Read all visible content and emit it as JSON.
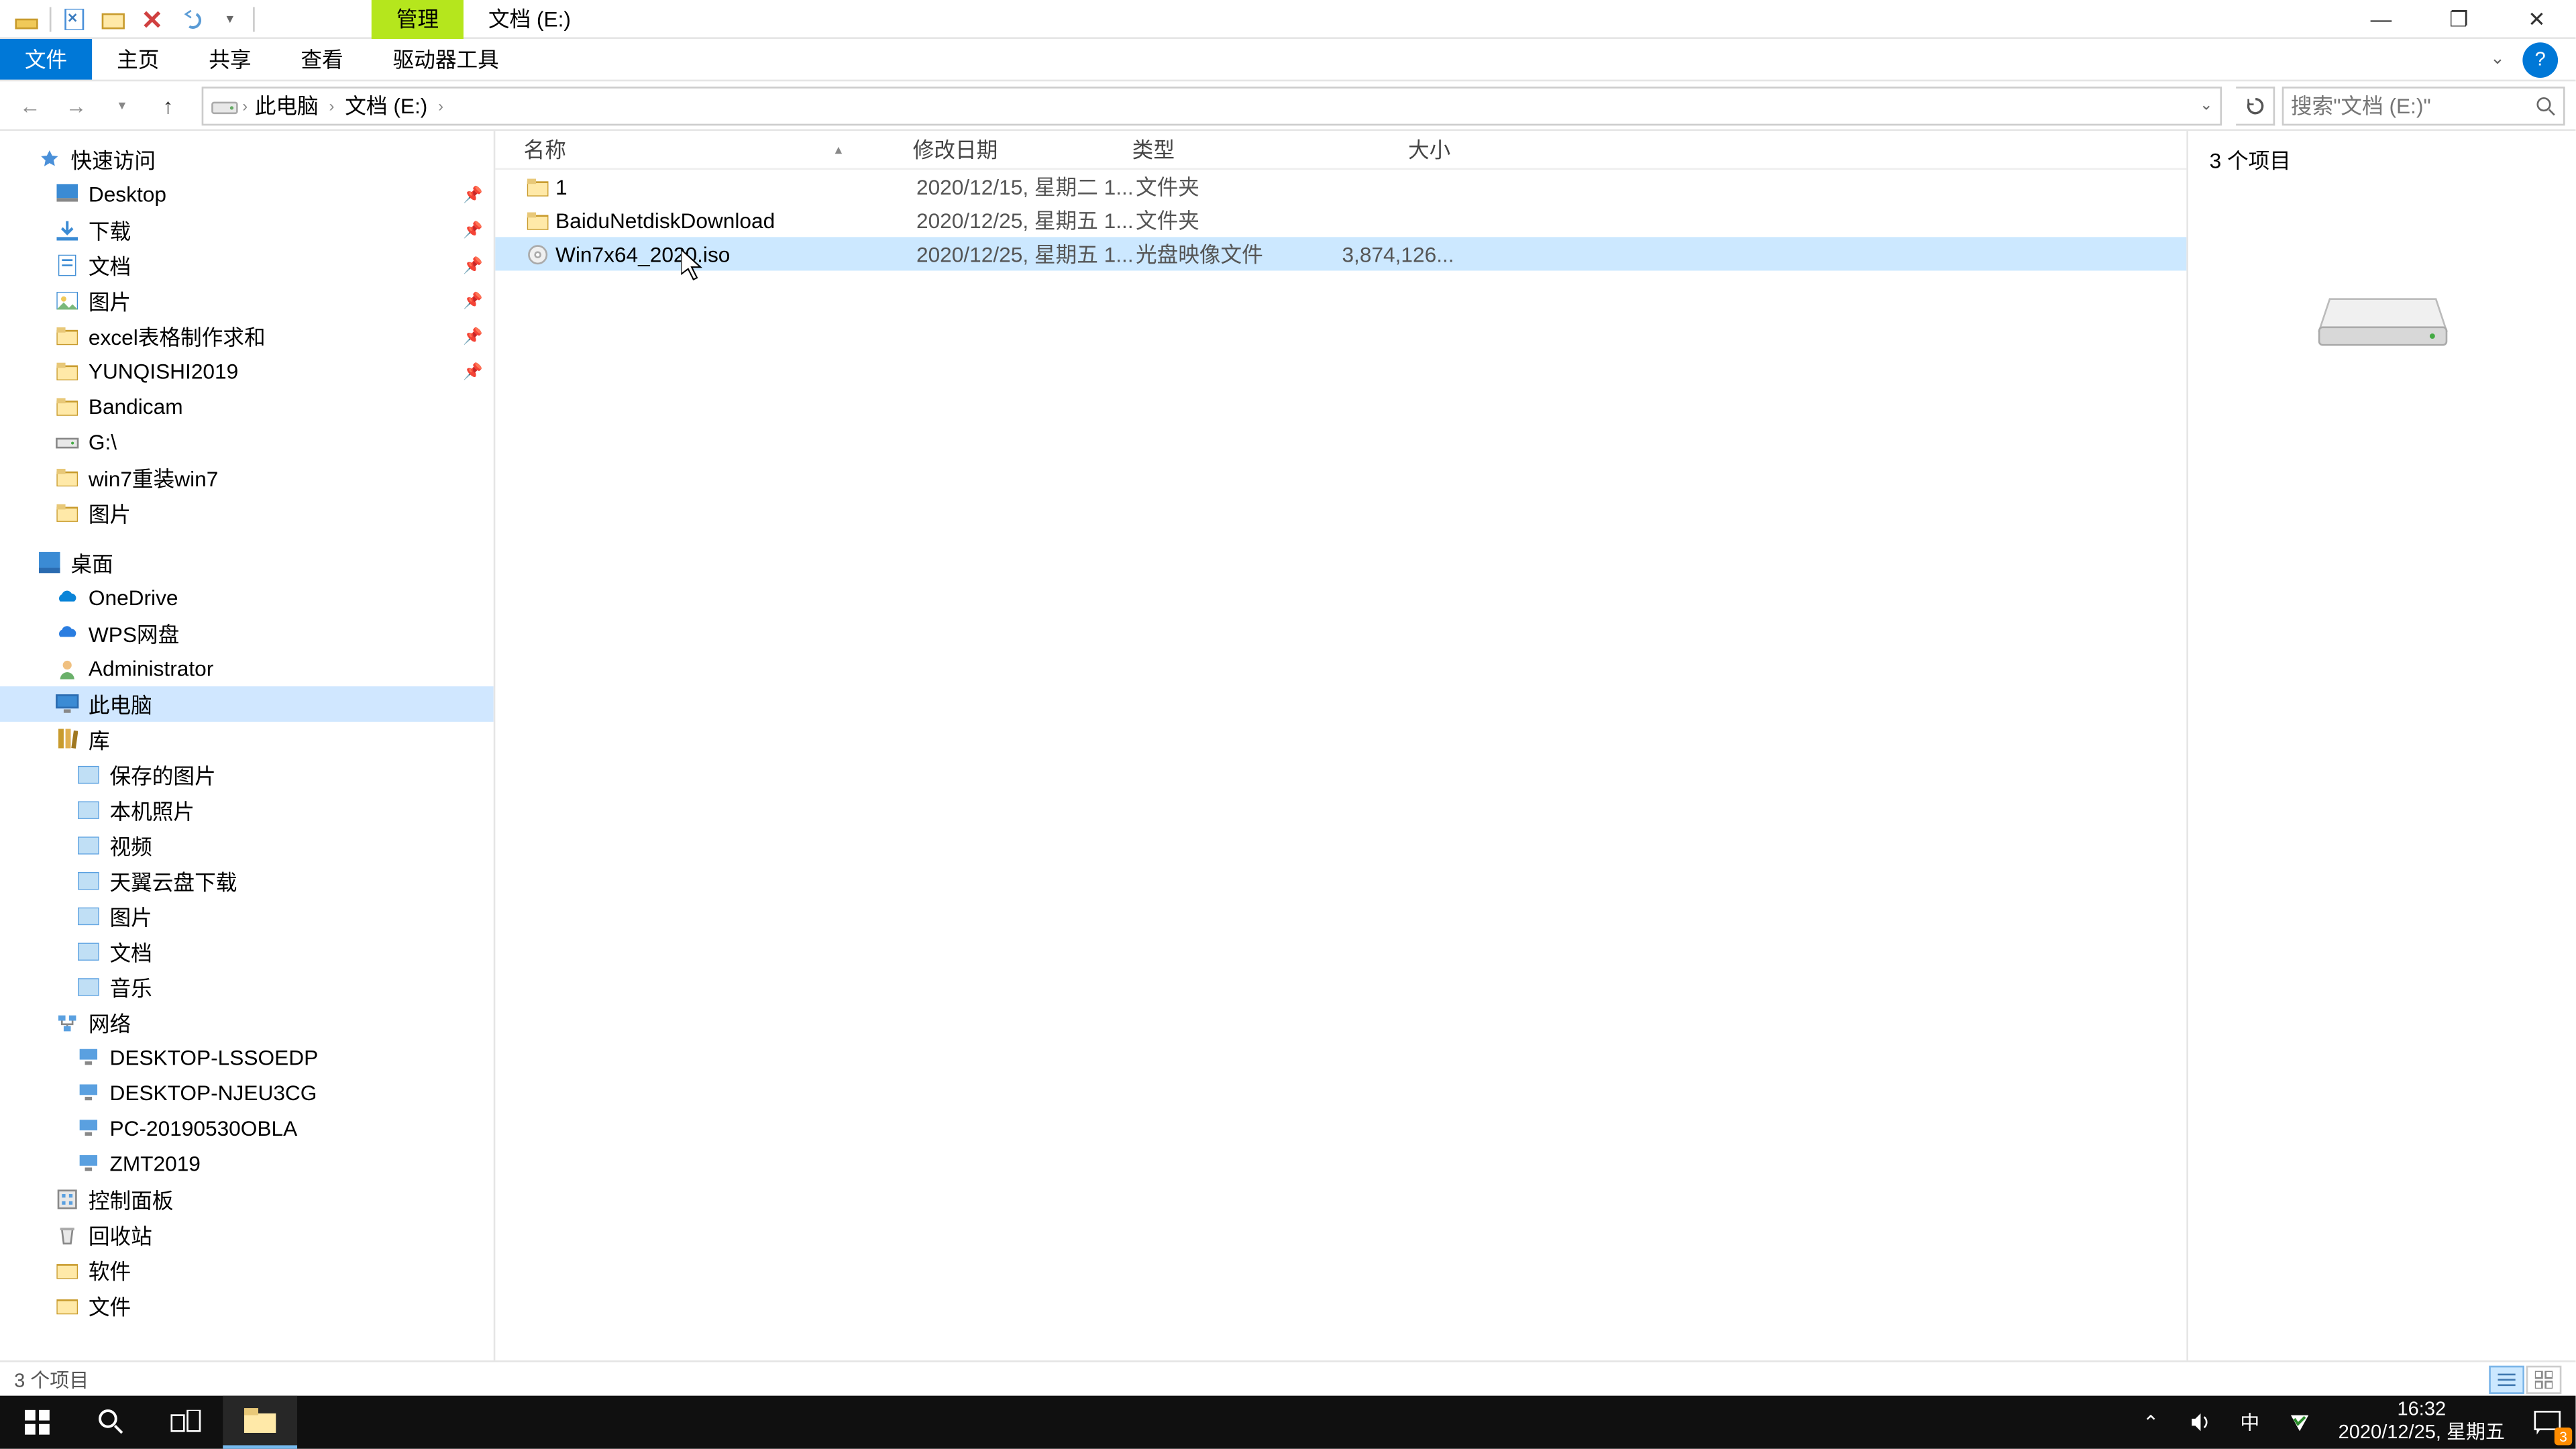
{
  "titlebar": {
    "context_tab": "管理",
    "title": "文档 (E:)"
  },
  "window_controls": {
    "minimize": "—",
    "maximize": "❐",
    "close": "✕"
  },
  "ribbon": {
    "file": "文件",
    "home": "主页",
    "share": "共享",
    "view": "查看",
    "drive_tools": "驱动器工具"
  },
  "nav": {
    "breadcrumb": [
      "此电脑",
      "文档 (E:)"
    ],
    "search_placeholder": "搜索\"文档 (E:)\""
  },
  "tree": {
    "quick_access": "快速访问",
    "qa_items": [
      {
        "label": "Desktop",
        "icon": "desktop"
      },
      {
        "label": "下载",
        "icon": "downloads"
      },
      {
        "label": "文档",
        "icon": "docs"
      },
      {
        "label": "图片",
        "icon": "pics"
      },
      {
        "label": "excel表格制作求和",
        "icon": "folder"
      },
      {
        "label": "YUNQISHI2019",
        "icon": "folder"
      },
      {
        "label": "Bandicam",
        "icon": "folder",
        "nopin": true
      },
      {
        "label": "G:\\",
        "icon": "drive",
        "nopin": true
      },
      {
        "label": "win7重装win7",
        "icon": "folder",
        "nopin": true
      },
      {
        "label": "图片",
        "icon": "folder",
        "nopin": true
      }
    ],
    "desktop": "桌面",
    "desktop_items": [
      {
        "label": "OneDrive",
        "icon": "onedrive"
      },
      {
        "label": "WPS网盘",
        "icon": "wps"
      },
      {
        "label": "Administrator",
        "icon": "user"
      },
      {
        "label": "此电脑",
        "icon": "pc",
        "selected": true
      },
      {
        "label": "库",
        "icon": "libs"
      }
    ],
    "lib_items": [
      {
        "label": "保存的图片"
      },
      {
        "label": "本机照片"
      },
      {
        "label": "视频"
      },
      {
        "label": "天翼云盘下载"
      },
      {
        "label": "图片"
      },
      {
        "label": "文档"
      },
      {
        "label": "音乐"
      }
    ],
    "network": "网络",
    "net_items": [
      {
        "label": "DESKTOP-LSSOEDP"
      },
      {
        "label": "DESKTOP-NJEU3CG"
      },
      {
        "label": "PC-20190530OBLA"
      },
      {
        "label": "ZMT2019"
      }
    ],
    "control_panel": "控制面板",
    "recycle": "回收站",
    "software": "软件",
    "docs2": "文件"
  },
  "columns": {
    "name": "名称",
    "date": "修改日期",
    "type": "类型",
    "size": "大小"
  },
  "files": [
    {
      "name": "1",
      "date": "2020/12/15, 星期二 1...",
      "type": "文件夹",
      "size": "",
      "icon": "folder"
    },
    {
      "name": "BaiduNetdiskDownload",
      "date": "2020/12/25, 星期五 1...",
      "type": "文件夹",
      "size": "",
      "icon": "folder"
    },
    {
      "name": "Win7x64_2020.iso",
      "date": "2020/12/25, 星期五 1...",
      "type": "光盘映像文件",
      "size": "3,874,126...",
      "icon": "iso",
      "selected": true
    }
  ],
  "preview": {
    "count": "3 个项目"
  },
  "statusbar": {
    "text": "3 个项目"
  },
  "taskbar": {
    "time": "16:32",
    "date": "2020/12/25, 星期五",
    "ime": "中",
    "notif_count": "3"
  }
}
